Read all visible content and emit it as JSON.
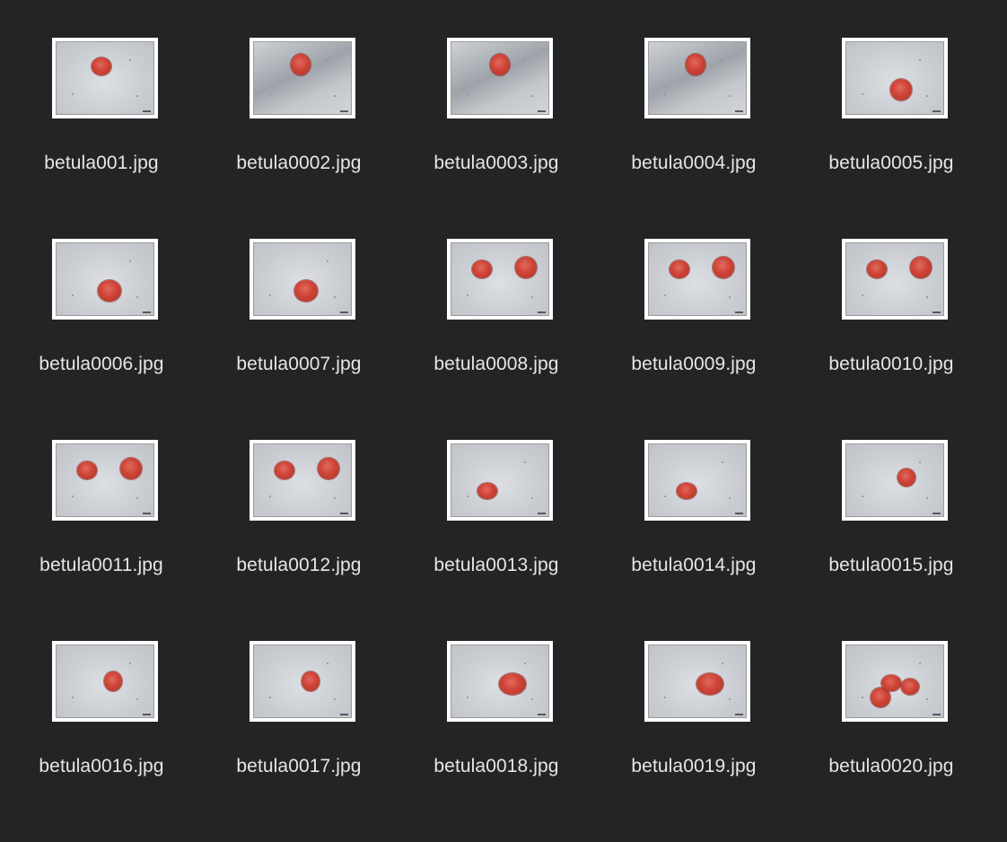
{
  "files": [
    {
      "name": "betula001.jpg",
      "bg": "light",
      "grains": 1
    },
    {
      "name": "betula0002.jpg",
      "bg": "dark",
      "grains": 1
    },
    {
      "name": "betula0003.jpg",
      "bg": "dark",
      "grains": 1
    },
    {
      "name": "betula0004.jpg",
      "bg": "dark",
      "grains": 1
    },
    {
      "name": "betula0005.jpg",
      "bg": "light",
      "grains": 1
    },
    {
      "name": "betula0006.jpg",
      "bg": "light",
      "grains": 1
    },
    {
      "name": "betula0007.jpg",
      "bg": "light",
      "grains": 1
    },
    {
      "name": "betula0008.jpg",
      "bg": "light",
      "grains": 2
    },
    {
      "name": "betula0009.jpg",
      "bg": "light",
      "grains": 2
    },
    {
      "name": "betula0010.jpg",
      "bg": "light",
      "grains": 2
    },
    {
      "name": "betula0011.jpg",
      "bg": "light",
      "grains": 2
    },
    {
      "name": "betula0012.jpg",
      "bg": "light",
      "grains": 2
    },
    {
      "name": "betula0013.jpg",
      "bg": "light",
      "grains": 1
    },
    {
      "name": "betula0014.jpg",
      "bg": "light",
      "grains": 1
    },
    {
      "name": "betula0015.jpg",
      "bg": "light",
      "grains": 1
    },
    {
      "name": "betula0016.jpg",
      "bg": "light",
      "grains": 1
    },
    {
      "name": "betula0017.jpg",
      "bg": "light",
      "grains": 1
    },
    {
      "name": "betula0018.jpg",
      "bg": "light",
      "grains": 1
    },
    {
      "name": "betula0019.jpg",
      "bg": "light",
      "grains": 1
    },
    {
      "name": "betula0020.jpg",
      "bg": "light",
      "grains": 3
    }
  ],
  "colors": {
    "background": "#232425",
    "label_text": "#e6e6e6",
    "thumb_border": "#ffffff",
    "grain": "#cf4336"
  }
}
